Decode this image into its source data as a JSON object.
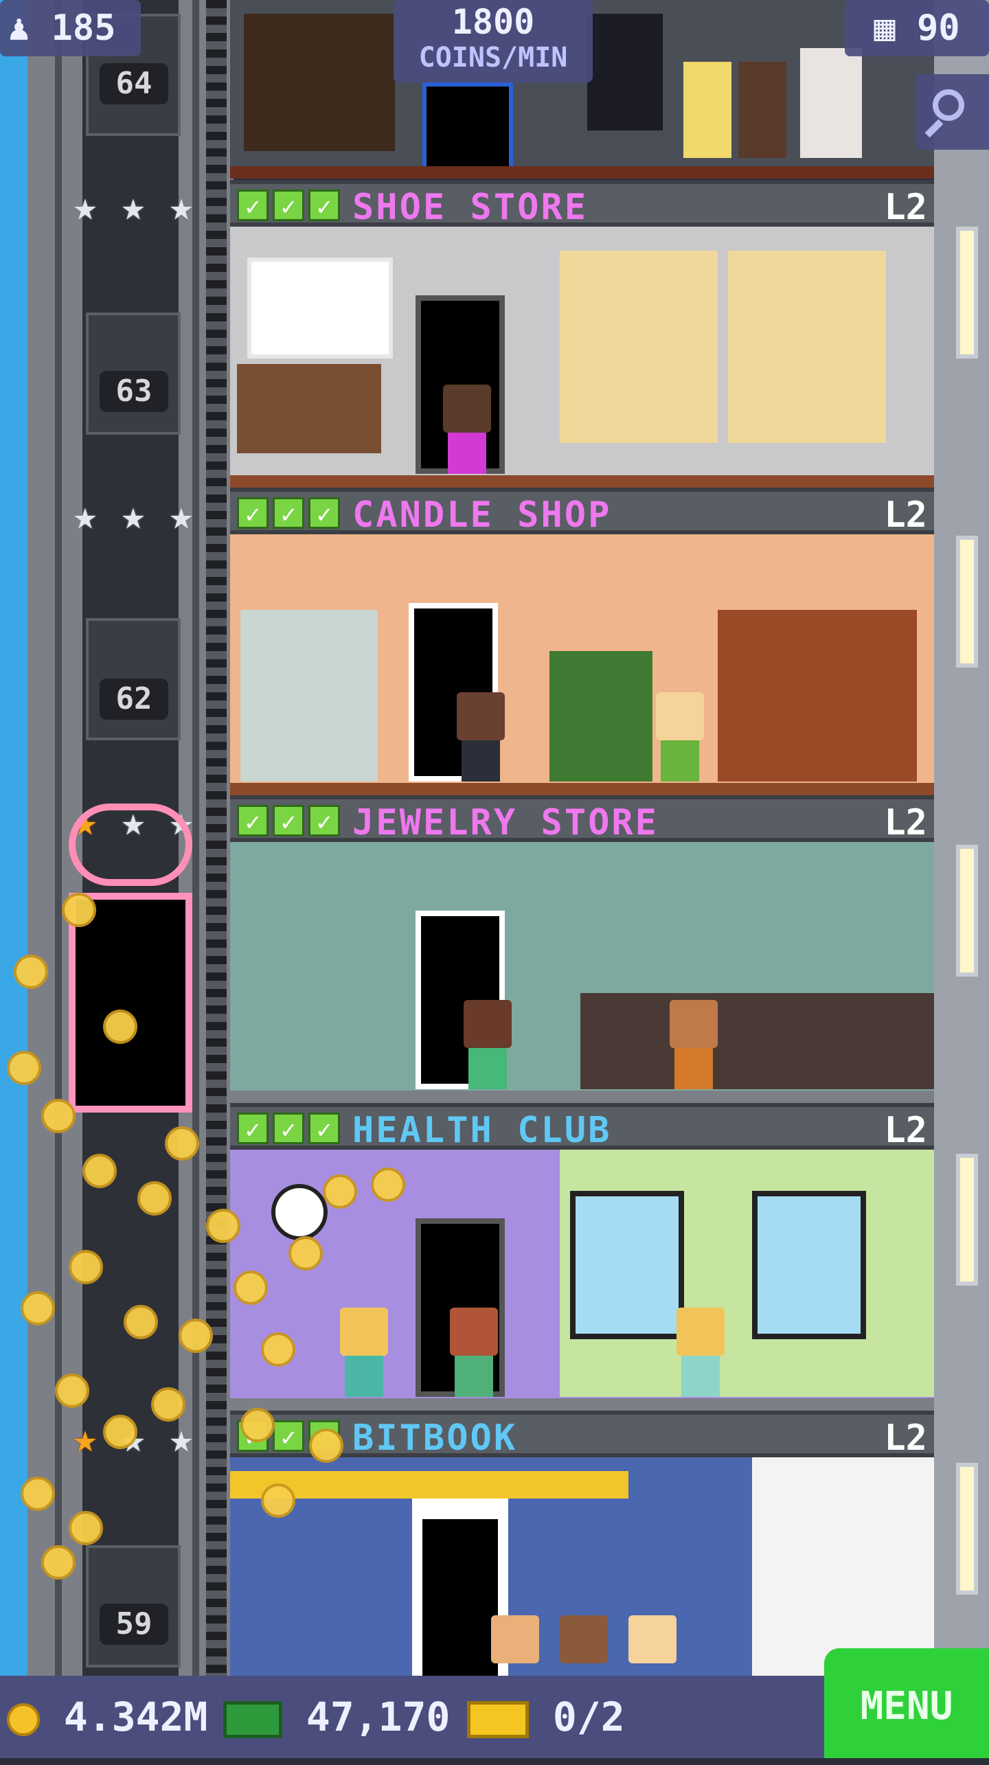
{
  "hud": {
    "population": "185",
    "coins_rate_value": "1800",
    "coins_rate_unit": "COINS/MIN",
    "floor_count": "90"
  },
  "icons": {
    "population": "person-icon",
    "floors": "building-icon",
    "search": "magnifier-icon",
    "coins": "coin-icon",
    "bux": "tower-bux-icon",
    "tickets": "vip-ticket-icon",
    "check": "check-icon",
    "star": "star-icon"
  },
  "elevator": {
    "floor_numbers": [
      "64",
      "63",
      "62",
      "59"
    ],
    "colors": {
      "shaft": "#7c7f86",
      "special_elevator": "#ff93bd"
    }
  },
  "floors": [
    {
      "name": "SHOE STORE",
      "level": "L2",
      "category": "retail",
      "checks": 3,
      "stars": [
        "silver",
        "silver",
        "silver"
      ]
    },
    {
      "name": "CANDLE SHOP",
      "level": "L2",
      "category": "retail",
      "checks": 3,
      "stars": [
        "silver",
        "silver",
        "silver"
      ]
    },
    {
      "name": "JEWELRY STORE",
      "level": "L2",
      "category": "retail",
      "checks": 3,
      "stars": [
        "gold",
        "silver",
        "silver"
      ]
    },
    {
      "name": "HEALTH CLUB",
      "level": "L2",
      "category": "service",
      "checks": 3,
      "stars": []
    },
    {
      "name": "BITBOOK",
      "level": "L2",
      "category": "service",
      "checks": 3,
      "stars": [
        "gold",
        "silver",
        "silver"
      ]
    }
  ],
  "bottom_bar": {
    "coins": "4.342M",
    "bux": "47,170",
    "tickets": "0/2",
    "menu_label": "MENU"
  },
  "colors": {
    "retail_name": "#ee78ee",
    "service_name": "#5fc8f4",
    "hud_bg": "#4a4c7e",
    "menu_bg": "#2fd13a"
  }
}
